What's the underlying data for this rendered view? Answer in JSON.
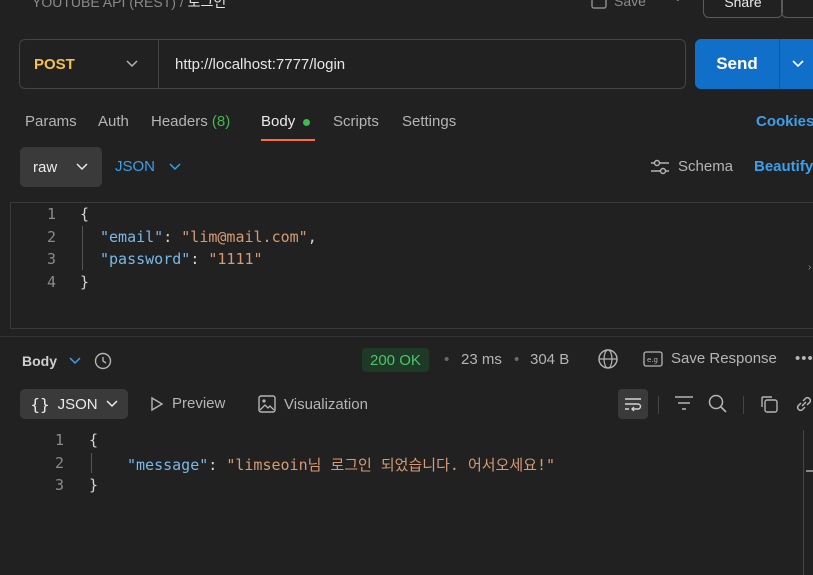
{
  "header": {
    "breadcrumb_parent": "YOUTUBE API (REST)",
    "breadcrumb_sep": "/",
    "breadcrumb_current": "로그인",
    "save_label": "Save",
    "share_label": "Share"
  },
  "request": {
    "method": "POST",
    "url": "http://localhost:7777/login",
    "send_label": "Send"
  },
  "tabs": {
    "params": "Params",
    "auth": "Auth",
    "headers": "Headers",
    "headers_count": "(8)",
    "body": "Body",
    "scripts": "Scripts",
    "settings": "Settings",
    "cookies": "Cookies"
  },
  "body_format": {
    "mode": "raw",
    "language": "JSON",
    "schema_label": "Schema",
    "beautify_label": "Beautify"
  },
  "request_body": {
    "line_numbers": [
      "1",
      "2",
      "3",
      "4"
    ],
    "open_brace": "{",
    "close_brace": "}",
    "email_key": "\"email\"",
    "email_value": "\"lim@mail.com\"",
    "password_key": "\"password\"",
    "password_value": "\"1111\"",
    "colon": ":",
    "comma": ","
  },
  "response": {
    "section_label": "Body",
    "status": "200 OK",
    "time": "23 ms",
    "size": "304 B",
    "save_response_label": "Save Response",
    "format_label": "JSON",
    "preview_label": "Preview",
    "visualization_label": "Visualization",
    "line_numbers": [
      "1",
      "2",
      "3"
    ],
    "open_brace": "{",
    "close_brace": "}",
    "message_key": "\"message\"",
    "message_value": "\"limseoin님 로그인 되었습니다. 어서오세요!\"",
    "colon": ":"
  },
  "colors": {
    "accent_orange": "#ff6c37",
    "send_blue": "#0f6fc9",
    "method_yellow": "#f2c14e",
    "status_green": "#4cc46a"
  }
}
